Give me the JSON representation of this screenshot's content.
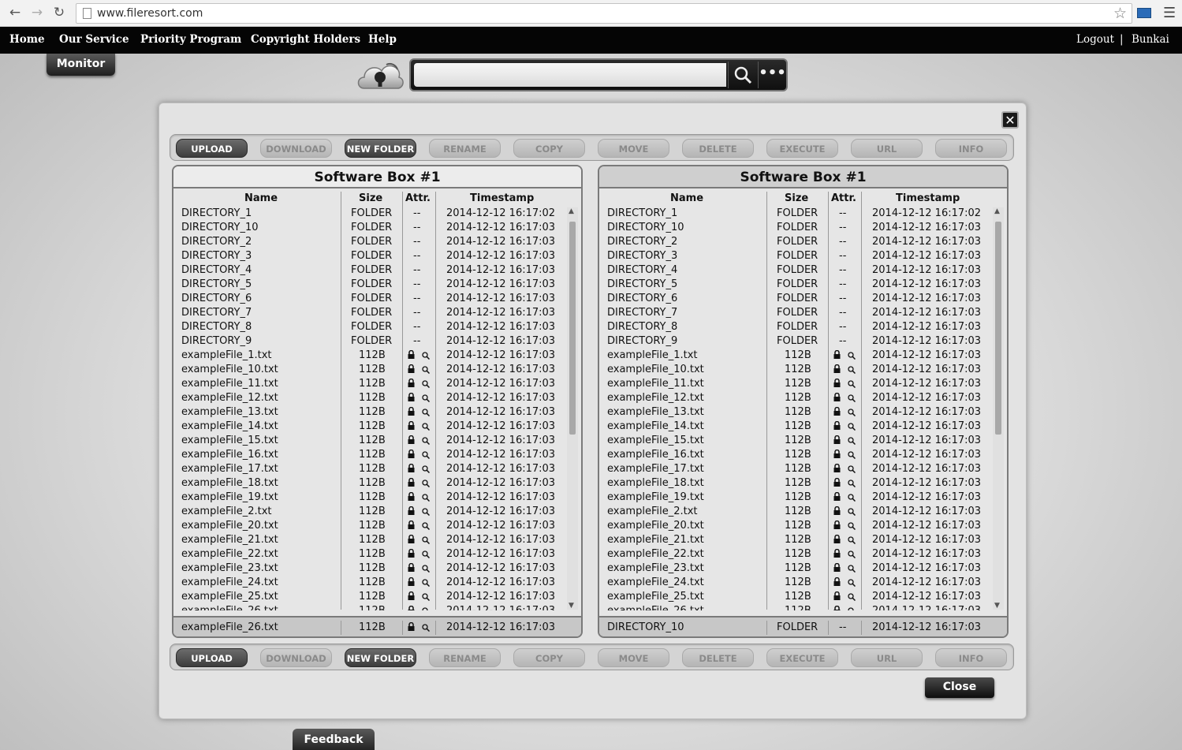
{
  "browser": {
    "url": "www.fileresort.com"
  },
  "nav": {
    "home": "Home",
    "service": "Our Service",
    "priority": "Priority Program",
    "copyright": "Copyright Holders",
    "help": "Help",
    "logout": "Logout",
    "separator": "|",
    "user": "Bunkai",
    "monitor": "Monitor"
  },
  "search": {
    "value": "________________________"
  },
  "toolbar": [
    "UPLOAD",
    "DOWNLOAD",
    "NEW FOLDER",
    "RENAME",
    "COPY",
    "MOVE",
    "DELETE",
    "EXECUTE",
    "URL",
    "INFO"
  ],
  "toolbar_active": [
    true,
    false,
    true,
    false,
    false,
    false,
    false,
    false,
    false,
    false
  ],
  "columns": {
    "name": "Name",
    "size": "Size",
    "attr": "Attr.",
    "timestamp": "Timestamp"
  },
  "left_panel": {
    "title": "Software Box #1",
    "selected": {
      "name": "exampleFile_26.txt",
      "size": "112B",
      "attr": "lock",
      "timestamp": "2014-12-12 16:17:03"
    }
  },
  "right_panel": {
    "title": "Software Box #1",
    "selected": {
      "name": "DIRECTORY_10",
      "size": "FOLDER",
      "attr": "--",
      "timestamp": "2014-12-12 16:17:03"
    }
  },
  "files": [
    {
      "name": "DIRECTORY_1",
      "size": "FOLDER",
      "attr": "--",
      "timestamp": "2014-12-12 16:17:02"
    },
    {
      "name": "DIRECTORY_10",
      "size": "FOLDER",
      "attr": "--",
      "timestamp": "2014-12-12 16:17:03"
    },
    {
      "name": "DIRECTORY_2",
      "size": "FOLDER",
      "attr": "--",
      "timestamp": "2014-12-12 16:17:03"
    },
    {
      "name": "DIRECTORY_3",
      "size": "FOLDER",
      "attr": "--",
      "timestamp": "2014-12-12 16:17:03"
    },
    {
      "name": "DIRECTORY_4",
      "size": "FOLDER",
      "attr": "--",
      "timestamp": "2014-12-12 16:17:03"
    },
    {
      "name": "DIRECTORY_5",
      "size": "FOLDER",
      "attr": "--",
      "timestamp": "2014-12-12 16:17:03"
    },
    {
      "name": "DIRECTORY_6",
      "size": "FOLDER",
      "attr": "--",
      "timestamp": "2014-12-12 16:17:03"
    },
    {
      "name": "DIRECTORY_7",
      "size": "FOLDER",
      "attr": "--",
      "timestamp": "2014-12-12 16:17:03"
    },
    {
      "name": "DIRECTORY_8",
      "size": "FOLDER",
      "attr": "--",
      "timestamp": "2014-12-12 16:17:03"
    },
    {
      "name": "DIRECTORY_9",
      "size": "FOLDER",
      "attr": "--",
      "timestamp": "2014-12-12 16:17:03"
    },
    {
      "name": "exampleFile_1.txt",
      "size": "112B",
      "attr": "lock",
      "timestamp": "2014-12-12 16:17:03"
    },
    {
      "name": "exampleFile_10.txt",
      "size": "112B",
      "attr": "lock",
      "timestamp": "2014-12-12 16:17:03"
    },
    {
      "name": "exampleFile_11.txt",
      "size": "112B",
      "attr": "lock",
      "timestamp": "2014-12-12 16:17:03"
    },
    {
      "name": "exampleFile_12.txt",
      "size": "112B",
      "attr": "lock",
      "timestamp": "2014-12-12 16:17:03"
    },
    {
      "name": "exampleFile_13.txt",
      "size": "112B",
      "attr": "lock",
      "timestamp": "2014-12-12 16:17:03"
    },
    {
      "name": "exampleFile_14.txt",
      "size": "112B",
      "attr": "lock",
      "timestamp": "2014-12-12 16:17:03"
    },
    {
      "name": "exampleFile_15.txt",
      "size": "112B",
      "attr": "lock",
      "timestamp": "2014-12-12 16:17:03"
    },
    {
      "name": "exampleFile_16.txt",
      "size": "112B",
      "attr": "lock",
      "timestamp": "2014-12-12 16:17:03"
    },
    {
      "name": "exampleFile_17.txt",
      "size": "112B",
      "attr": "lock",
      "timestamp": "2014-12-12 16:17:03"
    },
    {
      "name": "exampleFile_18.txt",
      "size": "112B",
      "attr": "lock",
      "timestamp": "2014-12-12 16:17:03"
    },
    {
      "name": "exampleFile_19.txt",
      "size": "112B",
      "attr": "lock",
      "timestamp": "2014-12-12 16:17:03"
    },
    {
      "name": "exampleFile_2.txt",
      "size": "112B",
      "attr": "lock",
      "timestamp": "2014-12-12 16:17:03"
    },
    {
      "name": "exampleFile_20.txt",
      "size": "112B",
      "attr": "lock",
      "timestamp": "2014-12-12 16:17:03"
    },
    {
      "name": "exampleFile_21.txt",
      "size": "112B",
      "attr": "lock",
      "timestamp": "2014-12-12 16:17:03"
    },
    {
      "name": "exampleFile_22.txt",
      "size": "112B",
      "attr": "lock",
      "timestamp": "2014-12-12 16:17:03"
    },
    {
      "name": "exampleFile_23.txt",
      "size": "112B",
      "attr": "lock",
      "timestamp": "2014-12-12 16:17:03"
    },
    {
      "name": "exampleFile_24.txt",
      "size": "112B",
      "attr": "lock",
      "timestamp": "2014-12-12 16:17:03"
    },
    {
      "name": "exampleFile_25.txt",
      "size": "112B",
      "attr": "lock",
      "timestamp": "2014-12-12 16:17:03"
    },
    {
      "name": "exampleFile_26.txt",
      "size": "112B",
      "attr": "lock",
      "timestamp": "2014-12-12 16:17:03"
    }
  ],
  "buttons": {
    "close": "Close",
    "feedback": "Feedback"
  }
}
